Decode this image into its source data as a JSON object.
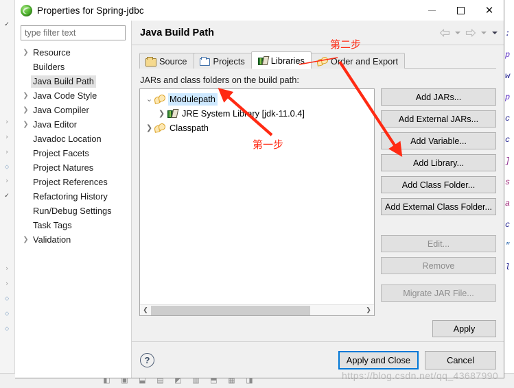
{
  "window": {
    "title": "Properties for Spring-jdbc",
    "app_icon": "eclipse-icon",
    "minimize_label": "Minimize",
    "maximize_label": "Maximize",
    "close_label": "Close"
  },
  "sidebar": {
    "filter_placeholder": "type filter text",
    "filter_value": "",
    "items": [
      {
        "label": "Resource",
        "expandable": true,
        "selected": false
      },
      {
        "label": "Builders",
        "expandable": false,
        "selected": false
      },
      {
        "label": "Java Build Path",
        "expandable": false,
        "selected": true
      },
      {
        "label": "Java Code Style",
        "expandable": true,
        "selected": false
      },
      {
        "label": "Java Compiler",
        "expandable": true,
        "selected": false
      },
      {
        "label": "Java Editor",
        "expandable": true,
        "selected": false
      },
      {
        "label": "Javadoc Location",
        "expandable": false,
        "selected": false
      },
      {
        "label": "Project Facets",
        "expandable": false,
        "selected": false
      },
      {
        "label": "Project Natures",
        "expandable": false,
        "selected": false
      },
      {
        "label": "Project References",
        "expandable": false,
        "selected": false
      },
      {
        "label": "Refactoring History",
        "expandable": false,
        "selected": false
      },
      {
        "label": "Run/Debug Settings",
        "expandable": false,
        "selected": false
      },
      {
        "label": "Task Tags",
        "expandable": false,
        "selected": false
      },
      {
        "label": "Validation",
        "expandable": true,
        "selected": false
      }
    ]
  },
  "page": {
    "title": "Java Build Path",
    "nav": {
      "back_label": "Back",
      "back_menu_label": "Back history",
      "forward_label": "Forward",
      "forward_menu_label": "Forward history",
      "view_menu_label": "View menu"
    },
    "tabs": [
      {
        "label": "Source",
        "icon": "package-folder-icon",
        "active": false
      },
      {
        "label": "Projects",
        "icon": "open-folder-icon",
        "active": false
      },
      {
        "label": "Libraries",
        "icon": "books-icon",
        "active": true
      },
      {
        "label": "Order and Export",
        "icon": "module-arrows-icon",
        "active": false
      }
    ],
    "content_label": "JARs and class folders on the build path:",
    "tree": [
      {
        "label": "Modulepath",
        "icon": "module-arrows-icon",
        "indent": 0,
        "twisty": "expanded",
        "selected": true
      },
      {
        "label": "JRE System Library [jdk-11.0.4]",
        "icon": "books-icon",
        "indent": 1,
        "twisty": "collapsed",
        "selected": false
      },
      {
        "label": "Classpath",
        "icon": "module-arrows-icon",
        "indent": 0,
        "twisty": "collapsed",
        "selected": false
      }
    ],
    "scrollbar": {
      "left_label": "Scroll left",
      "right_label": "Scroll right",
      "thumb_percent": 75
    },
    "buttons": [
      {
        "label": "Add JARs...",
        "enabled": true
      },
      {
        "label": "Add External JARs...",
        "enabled": true
      },
      {
        "label": "Add Variable...",
        "enabled": true
      },
      {
        "label": "Add Library...",
        "enabled": true
      },
      {
        "label": "Add Class Folder...",
        "enabled": true
      },
      {
        "label": "Add External Class Folder...",
        "enabled": true
      },
      {
        "label": "Edit...",
        "enabled": false
      },
      {
        "label": "Remove",
        "enabled": false
      },
      {
        "label": "Migrate JAR File...",
        "enabled": false
      }
    ],
    "apply_label": "Apply"
  },
  "footer": {
    "help_label": "?",
    "apply_and_close_label": "Apply and Close",
    "cancel_label": "Cancel"
  },
  "annotations": {
    "step_one": "第一步",
    "step_two": "第二步",
    "arrow_color": "#ff2a13"
  },
  "watermark": "https://blog.csdn.net/qq_43687990",
  "background": {
    "code_lines": [
      {
        "text": ":",
        "color": "#1f1f8f"
      },
      {
        "text": "p",
        "color": "#5b2fc4"
      },
      {
        "text": "w",
        "color": "#1f1f8f"
      },
      {
        "text": "p",
        "color": "#5b2fc4"
      },
      {
        "text": "c",
        "color": "#1f1f8f"
      },
      {
        "text": "c",
        "color": "#1f1f8f"
      },
      {
        "text": "]",
        "color": "#8f2f8f"
      },
      {
        "text": "s",
        "color": "#a0287a"
      },
      {
        "text": "a",
        "color": "#a0287a"
      },
      {
        "text": "c",
        "color": "#1f1f8f"
      },
      {
        "text": "\"",
        "color": "#1f5fa8"
      },
      {
        "text": "l",
        "color": "#1f1f8f"
      }
    ]
  }
}
